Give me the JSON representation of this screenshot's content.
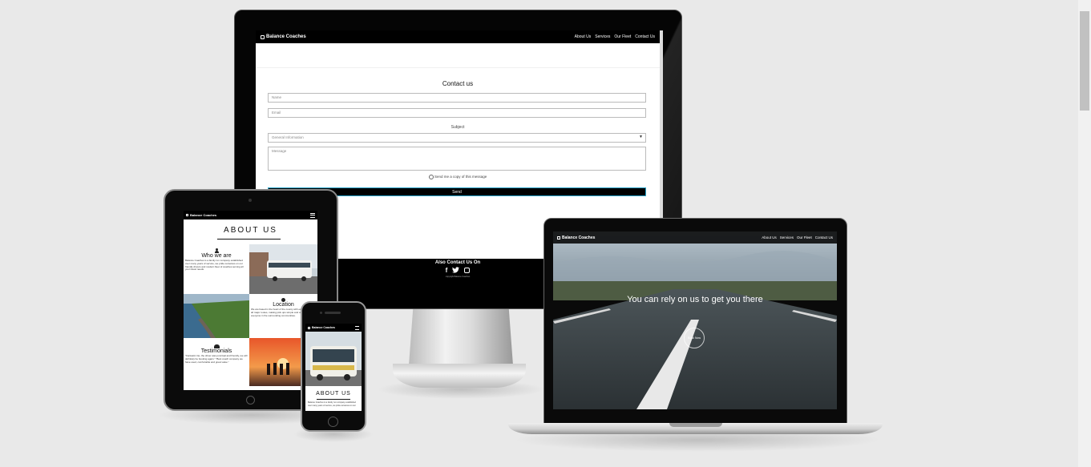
{
  "brand": "Balance Coaches",
  "nav_links": [
    "About Us",
    "Services",
    "Our Fleet",
    "Contact Us"
  ],
  "contact": {
    "title": "Contact us",
    "name_placeholder": "Name",
    "email_placeholder": "Email",
    "subject_label": "Subject",
    "subject_value": "General Information",
    "message_placeholder": "Message",
    "copy_label": "Send me a copy of this message",
    "send_label": "Send"
  },
  "footer": {
    "title": "Also Contact Us On",
    "social_icons": [
      "facebook-icon",
      "twitter-icon",
      "instagram-icon"
    ],
    "copyright": "copyright Balance Coaches"
  },
  "hero": {
    "tagline": "You can rely on us to get you there",
    "cta_label": "Book Now"
  },
  "about": {
    "title": "ABOUT US",
    "who_title": "Who we are",
    "who_text": "Balance Coaches is a family run company established over many years of service, we pride ourselves on our friendly drivers and modern fleet of coaches serving all your travel needs.",
    "location_title": "Location",
    "location_text": "We are based in the heart of the county with easy access to all major routes, making pick ups simple and convenient for everyone in the surrounding communities.",
    "testimonials_title": "Testimonials",
    "testimonials_text": "\"Fantastic trip, the driver was punctual and friendly, we will definitely be booking again.\" \"Best coach company we have used, comfortable and great value.\""
  },
  "colors": {
    "background": "#e9e9e9",
    "nav": "#000000",
    "hero_sky": "#8ea0b0",
    "hero_road": "#3a4246"
  }
}
